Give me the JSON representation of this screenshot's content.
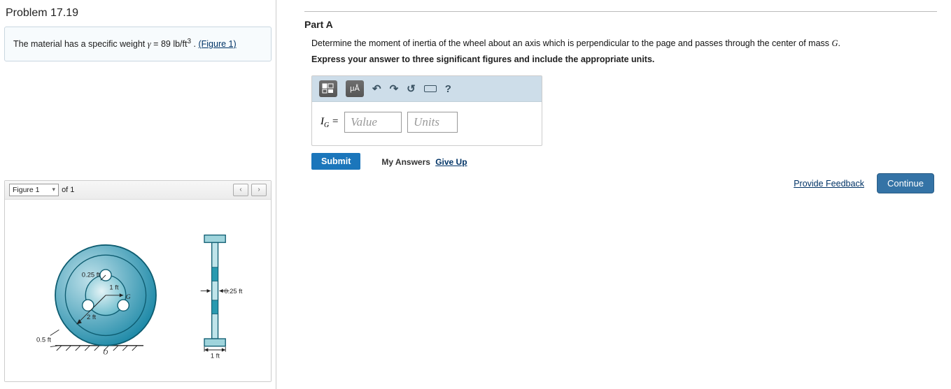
{
  "problem": {
    "title": "Problem 17.19",
    "statement_prefix": "The material has a specific weight ",
    "gamma_sym": "γ",
    "equals": " = 89 ",
    "unit": "lb/ft",
    "unit_sup": "3",
    "statement_suffix": " . ",
    "figure_link": "(Figure 1)"
  },
  "figure": {
    "selector_label": "Figure 1",
    "of_label": "of 1",
    "prev": "‹",
    "next": "›",
    "dims": {
      "r_inner": "0.25 ft",
      "r_mid": "1 ft",
      "r_outer": "2 ft",
      "thick": "0.5 ft",
      "g_label": "G",
      "o_label": "O",
      "side_thick": "0.25 ft",
      "side_base": "1 ft"
    }
  },
  "part": {
    "label": "Part A",
    "question": "Determine the moment of inertia of the wheel about an axis which is perpendicular to the page and passes through the center of mass ",
    "g": "G",
    "period": ".",
    "instruction": "Express your answer to three significant figures and include the appropriate units."
  },
  "toolbar": {
    "templates_icon": "▦",
    "symbols": "μÅ",
    "undo": "↶",
    "redo": "↷",
    "reset": "↺",
    "keyboard": "kbd",
    "help": "?"
  },
  "answer": {
    "lhs": "I",
    "lhs_sub": "G",
    "eq": " = ",
    "value_placeholder": "Value",
    "units_placeholder": "Units"
  },
  "actions": {
    "submit": "Submit",
    "my_answers": "My Answers",
    "give_up": "Give Up",
    "provide_feedback": "Provide Feedback",
    "continue": "Continue"
  }
}
